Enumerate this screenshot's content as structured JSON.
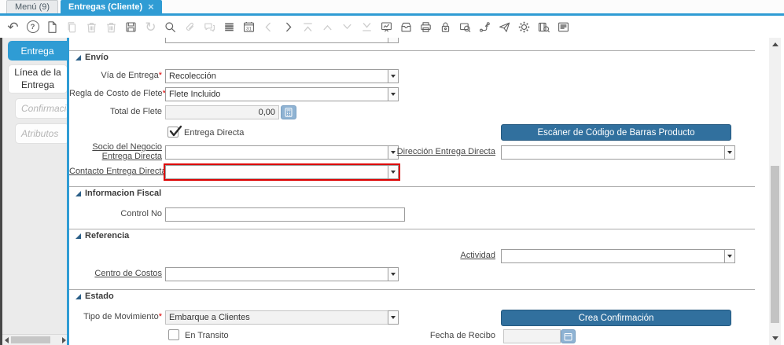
{
  "colors": {
    "accent": "#2f9cd4",
    "button_blue": "#31709e",
    "light_blue_button": "#8fb3d3",
    "required_mark": "#dd0000",
    "focus_border": "#dd0000"
  },
  "tabbar": {
    "menu_tab": "Menú (9)",
    "active_tab": "Entregas (Cliente)",
    "close_glyph": "×"
  },
  "toolbar": {
    "calendar_day": "31",
    "icons": [
      {
        "name": "undo",
        "enabled": true
      },
      {
        "name": "help",
        "enabled": true
      },
      {
        "name": "new-record",
        "enabled": true
      },
      {
        "name": "copy-record",
        "enabled": false
      },
      {
        "name": "delete-record",
        "enabled": false
      },
      {
        "name": "delete-selection",
        "enabled": false
      },
      {
        "name": "save",
        "enabled": true
      },
      {
        "name": "refresh",
        "enabled": false
      },
      {
        "name": "find",
        "enabled": true
      },
      {
        "name": "attachment",
        "enabled": false
      },
      {
        "name": "chat",
        "enabled": false
      },
      {
        "name": "grid-toggle",
        "enabled": true
      },
      {
        "name": "calendar",
        "enabled": true
      },
      {
        "name": "previous-record",
        "enabled": false
      },
      {
        "name": "next-record",
        "enabled": true
      },
      {
        "name": "first-record",
        "enabled": false
      },
      {
        "name": "parent-record",
        "enabled": false
      },
      {
        "name": "detail-record",
        "enabled": false
      },
      {
        "name": "last-record",
        "enabled": false
      },
      {
        "name": "report",
        "enabled": true
      },
      {
        "name": "archive",
        "enabled": true
      },
      {
        "name": "print",
        "enabled": true
      },
      {
        "name": "lock",
        "enabled": true
      },
      {
        "name": "record-info",
        "enabled": true
      },
      {
        "name": "workflow",
        "enabled": true
      },
      {
        "name": "share",
        "enabled": true
      },
      {
        "name": "process",
        "enabled": true
      },
      {
        "name": "product-attribute",
        "enabled": true
      },
      {
        "name": "report-view",
        "enabled": true
      }
    ]
  },
  "sidebar": {
    "tabs": [
      {
        "label": "Entrega",
        "state": "active"
      },
      {
        "label": "Línea de la Entrega",
        "state": "normal"
      },
      {
        "label": "Confirmación",
        "state": "disabled"
      },
      {
        "label": "Atributos",
        "state": "disabled"
      }
    ]
  },
  "form": {
    "required_mark": "*",
    "envio": {
      "title": "Envío",
      "via": {
        "label": "Vía de Entrega",
        "required": true,
        "value": "Recolección"
      },
      "regla": {
        "label": "Regla de Costo de Flete",
        "required": true,
        "value": "Flete Incluido"
      },
      "flete": {
        "label": "Total de Flete",
        "value": "0,00"
      },
      "entrega_directa": {
        "label": "Entrega Directa",
        "checked": true
      },
      "socio": {
        "label": "Socio del Negocio Entrega Directa",
        "value": ""
      },
      "direccion": {
        "label": "Dirección Entrega Directa",
        "value": ""
      },
      "contacto": {
        "label": "Contacto Entrega Directa",
        "value": ""
      },
      "scanner_button": "Escáner de Código de Barras Producto"
    },
    "fiscal": {
      "title": "Informacion Fiscal",
      "control_no": {
        "label": "Control No",
        "value": ""
      }
    },
    "referencia": {
      "title": "Referencia",
      "actividad": {
        "label": "Actividad",
        "value": ""
      },
      "centro_costos": {
        "label": "Centro de Costos",
        "value": ""
      }
    },
    "estado": {
      "title": "Estado",
      "tipo": {
        "label": "Tipo de Movimiento",
        "required": true,
        "value": "Embarque a Clientes"
      },
      "crea_button": "Crea Confirmación",
      "en_transito": {
        "label": "En Transito",
        "checked": false
      },
      "fecha_recibo": {
        "label": "Fecha de Recibo",
        "value": ""
      }
    }
  }
}
